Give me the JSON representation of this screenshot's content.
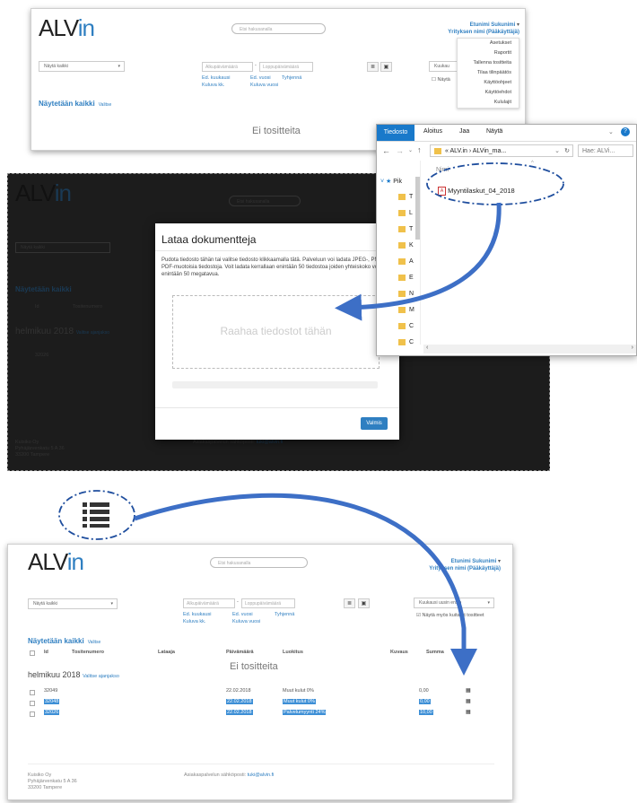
{
  "app": {
    "logo_main": "ALV",
    "logo_suffix": "in",
    "search_placeholder": "Etsi hakusanalla",
    "user_name": "Etunimi Sukunimi",
    "user_company": "Yrityksen nimi (Pääkäyttäjä)",
    "user_caret": "▾"
  },
  "filters": {
    "show_select": "Näytä kaikki",
    "start_date_placeholder": "Alkupäivämäärä",
    "end_date_placeholder": "Loppupäivämäärä",
    "date_dash": "-",
    "prev_month": "Ed. kuukausi",
    "prev_year": "Ed. vuosi",
    "current_month": "Kuluva kk.",
    "current_year": "Kuluva vuosi",
    "clear": "Tyhjennä",
    "sort_select": "Kuukausi uusin ensin",
    "show_paid": "Näytä myös kuitatut tositteet"
  },
  "top_screen": {
    "sort_select_short": "Kuukau",
    "show_paid_short": "Näytä",
    "heading": "Näytetään kaikki",
    "choose": "Valitse",
    "empty": "Ei tositteita"
  },
  "user_menu": {
    "items": [
      "Asetukset",
      "Raportit",
      "Tallenna tositteita",
      "Tilaa tilinpäätös",
      "Käyttöohjeet",
      "Käyttöehdot",
      "Kululajit"
    ]
  },
  "explorer": {
    "tab_file": "Tiedosto",
    "tab_home": "Aloitus",
    "tab_share": "Jaa",
    "tab_view": "Näytä",
    "address": "« ALV.in › ALVin_ma...",
    "search": "Hae: ALVi...",
    "column_name": "Nimi",
    "tree_quick": "Pik",
    "tree_items": [
      "T",
      "L",
      "T",
      "K",
      "A",
      "E",
      "N",
      "M",
      "C",
      "C"
    ],
    "file": "Myyntilaskut_04_2018"
  },
  "modal": {
    "title": "Lataa dokumentteja",
    "text": "Pudota tiedosto tähän tai valitse tiedosto klikkaamalla tätä. Palveluun voi ladata JPEG-, PNG- ja PDF-muotoisia tiedostoja. Voit ladata kerrallaan enintään 50 tiedostoa joiden yhteiskoko voi olla enintään 50 megatavua.",
    "drop": "Raahaa tiedostot tähän",
    "done": "Valmis"
  },
  "dark_screen": {
    "search": "Etsi hakusanalla",
    "show": "Näytä kaikki",
    "heading": "Näytetään kaikki",
    "col_id": "Id",
    "col_number": "Tositenumero",
    "month": "helmikuu 2018",
    "month_link": "Valitse ajanjakso",
    "row_id": "32026",
    "row_sum": "10,00",
    "footer_company": "Kuisiko Oy",
    "footer_address": "Pyhäjärvenkatu 5 A 36",
    "footer_city": "33200 Tampere",
    "footer_support": "Asiakaspalvelun sähköposti:",
    "footer_email": "tuki@alvin.fi"
  },
  "bottom_screen": {
    "heading": "Näytetään kaikki",
    "choose": "Valitse",
    "columns": [
      "Id",
      "Tositenumero",
      "Lataaja",
      "Päivämäärä",
      "Luokitus",
      "Kuvaus",
      "Summa"
    ],
    "empty": "Ei tositteita",
    "month": "helmikuu 2018",
    "month_link": "Valitse ajanjakso",
    "rows": [
      {
        "id": "32049",
        "date": "22.02.2018",
        "class": "Muut kulut 0%",
        "sum": "0,00",
        "selected": false
      },
      {
        "id": "32048",
        "date": "22.02.2018",
        "class": "Muut kulut 0%",
        "sum": "0,00",
        "selected": true
      },
      {
        "id": "32026",
        "date": "22.02.2018",
        "class": "Palvelumyynti 24%",
        "sum": "10,00",
        "selected": true
      }
    ],
    "footer_company": "Kuisiko Oy",
    "footer_address": "Pyhäjärvenkatu 5 A 36",
    "footer_city": "33200 Tampere",
    "footer_support": "Asiakaspalvelun sähköposti:",
    "footer_email": "tuki@alvin.fi"
  },
  "colors": {
    "accent": "#2f7fc1",
    "arrow": "#3d6fc6",
    "highlight": "#3d8fd6"
  }
}
